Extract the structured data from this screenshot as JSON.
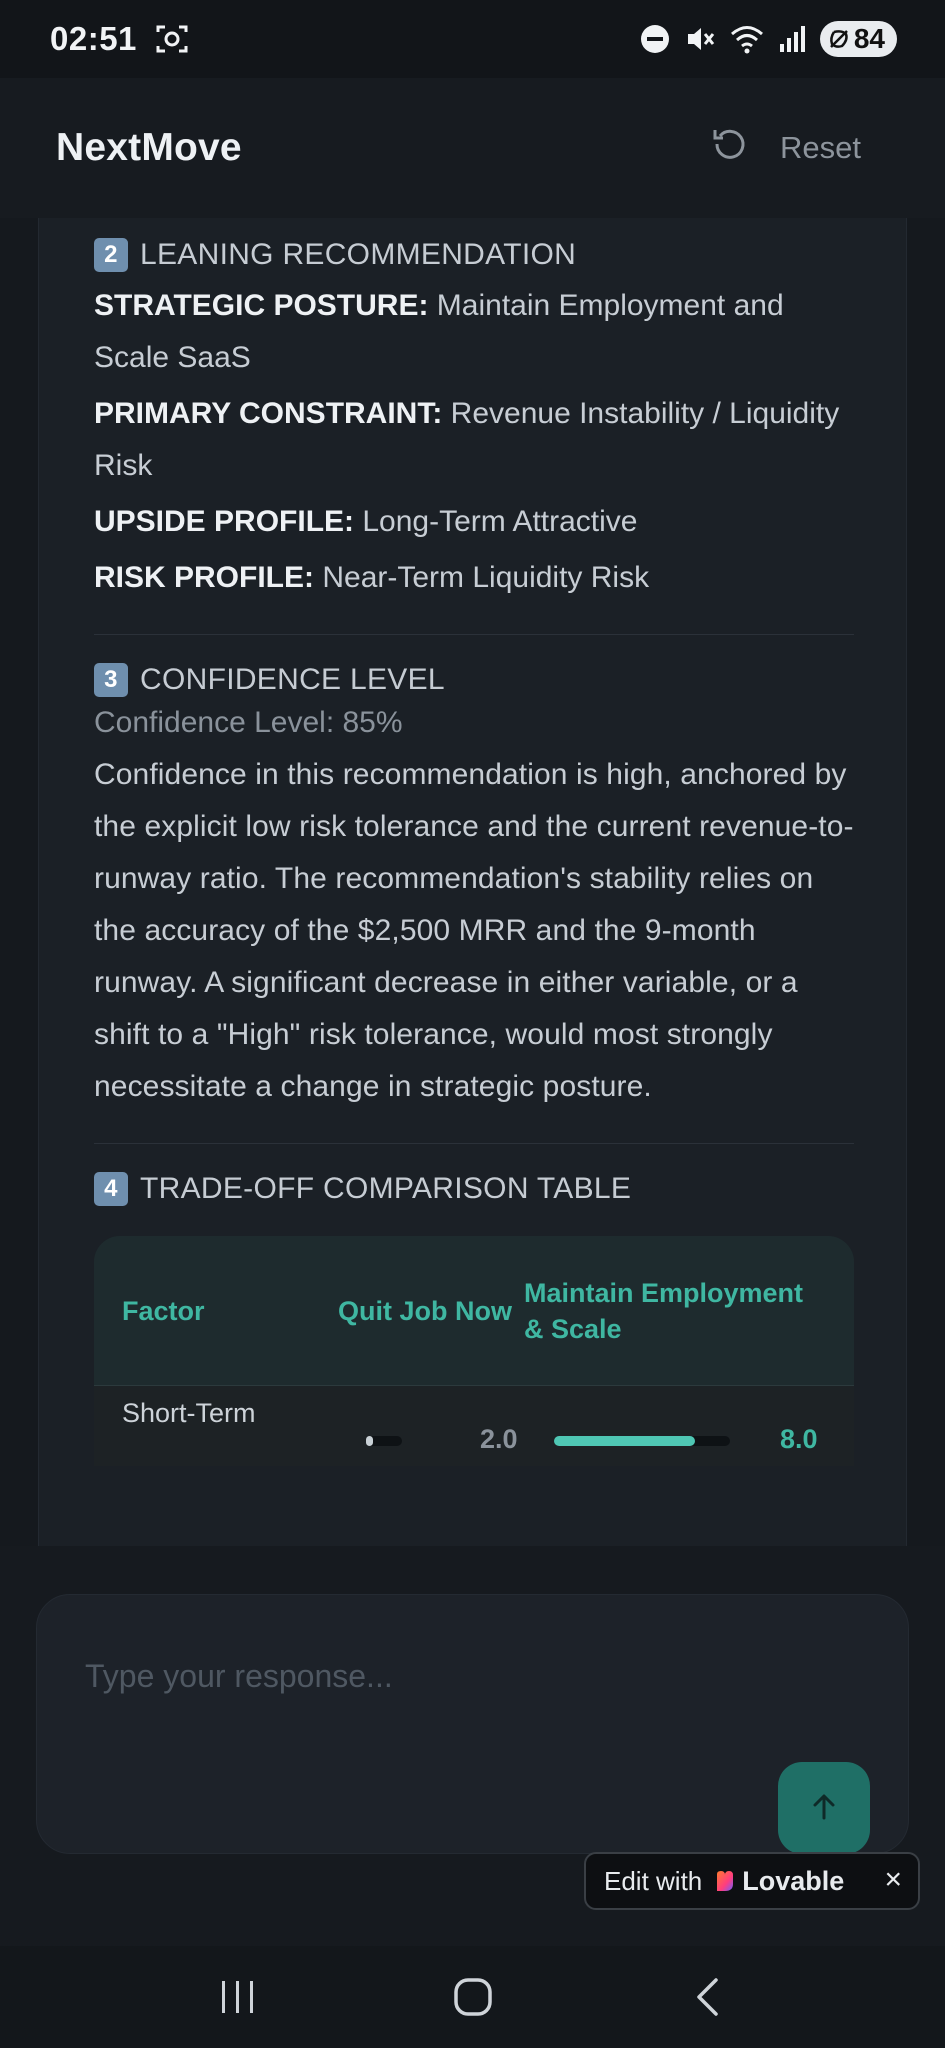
{
  "status_bar": {
    "time": "02:51",
    "battery": "84",
    "icons": [
      "screen-record-icon",
      "dnd-icon",
      "mute-icon",
      "wifi-icon",
      "signal-icon",
      "battery-icon"
    ]
  },
  "header": {
    "title": "NextMove",
    "reset_label": "Reset"
  },
  "section2": {
    "badge": "2",
    "title": "LEANING RECOMMENDATION",
    "items": [
      {
        "label": "STRATEGIC POSTURE:",
        "value": " Maintain Employment and Scale SaaS"
      },
      {
        "label": "PRIMARY CONSTRAINT:",
        "value": " Revenue Instability / Liquidity Risk"
      },
      {
        "label": "UPSIDE PROFILE:",
        "value": " Long-Term Attractive"
      },
      {
        "label": "RISK PROFILE:",
        "value": " Near-Term Liquidity Risk"
      }
    ]
  },
  "section3": {
    "badge": "3",
    "title": "CONFIDENCE LEVEL",
    "subtitle": "Confidence Level: 85%",
    "body": "Confidence in this recommendation is high, anchored by the explicit low risk tolerance and the current revenue-to-runway ratio. The recommendation's stability relies on the accuracy of the $2,500 MRR and the 9-month runway. A significant decrease in either variable, or a shift to a \"High\" risk tolerance, would most strongly necessitate a change in strategic posture."
  },
  "section4": {
    "badge": "4",
    "title": "TRADE-OFF COMPARISON TABLE",
    "table": {
      "headers": [
        "Factor",
        "Quit Job Now",
        "Maintain Employment & Scale"
      ],
      "rows": [
        {
          "factor": "Short-Term",
          "quit_value": "2.0",
          "maintain_value": "8.0",
          "quit_fraction": 0.2,
          "maintain_fraction": 0.8
        }
      ]
    }
  },
  "composer": {
    "placeholder": "Type your response...",
    "send_icon": "arrow-up-icon"
  },
  "lovable_badge": {
    "prefix": "Edit with",
    "brand": "Lovable",
    "close": "×"
  },
  "colors": {
    "accent": "#3fb7a2",
    "send_button": "#1f6f66",
    "background": "#15191e"
  }
}
